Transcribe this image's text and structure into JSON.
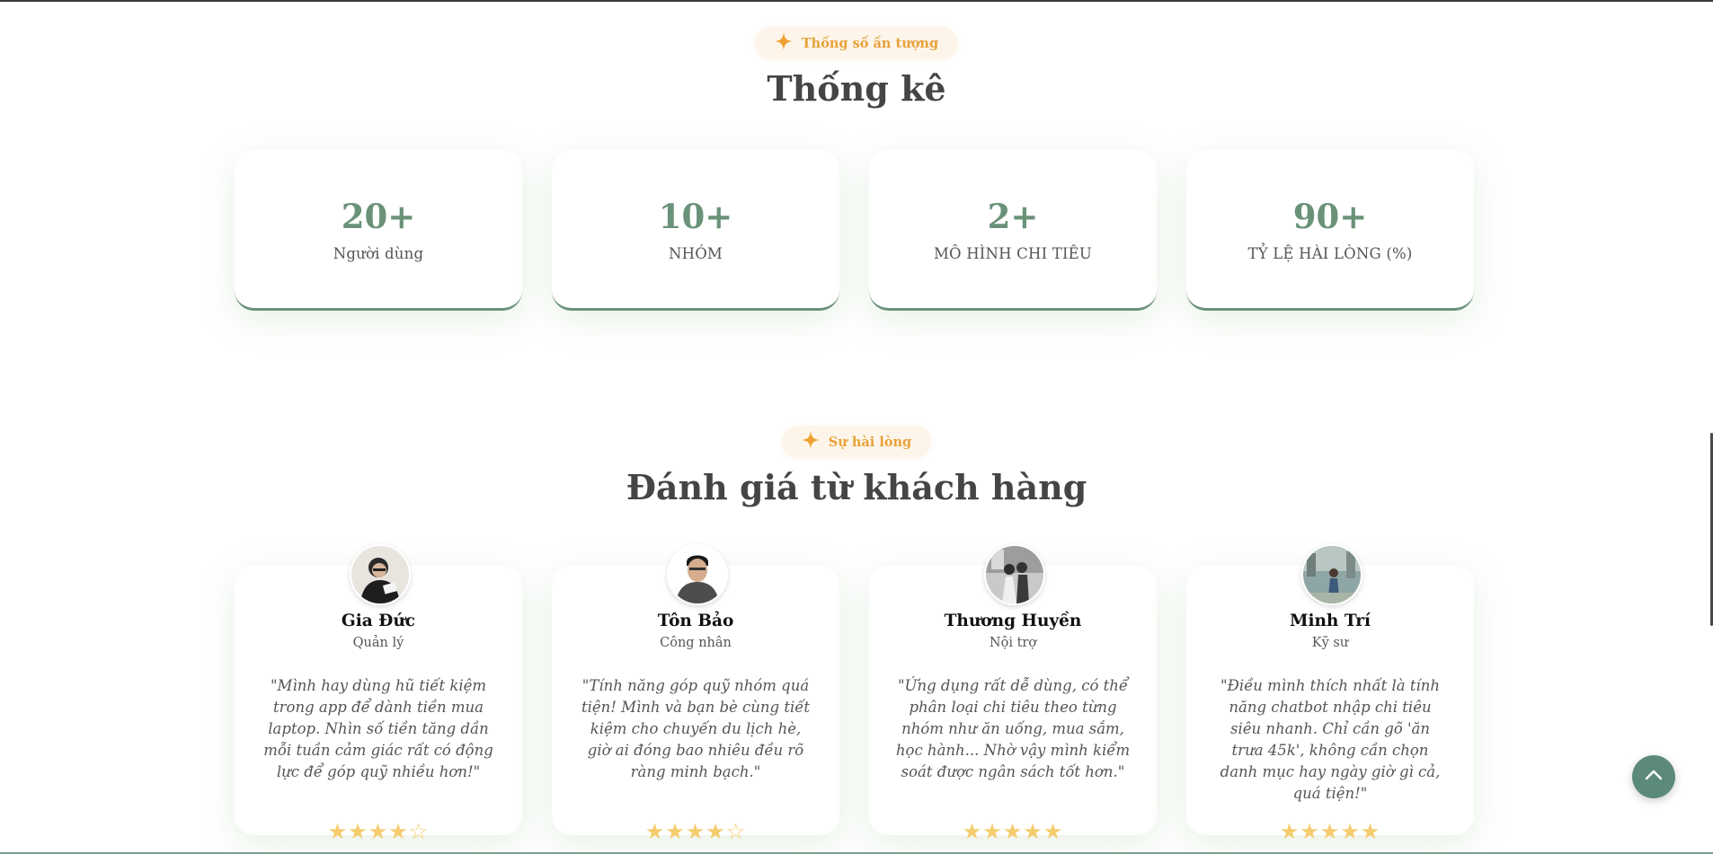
{
  "stats_section": {
    "badge": "Thống số ấn tượng",
    "title": "Thống kê",
    "cards": [
      {
        "value": "20+",
        "label": "Người dùng"
      },
      {
        "value": "10+",
        "label": "NHÓM"
      },
      {
        "value": "2+",
        "label": "MÔ HÌNH CHI TIÊU"
      },
      {
        "value": "90+",
        "label": "TỶ LỆ HÀI LÒNG (%)"
      }
    ]
  },
  "reviews_section": {
    "badge": "Sự hài lòng",
    "title": "Đánh giá từ khách hàng",
    "reviews": [
      {
        "name": "Gia Đức",
        "role": "Quản lý",
        "quote": "\"Mình hay dùng hũ tiết kiệm trong app để dành tiền mua laptop. Nhìn số tiền tăng dần mỗi tuần cảm giác rất có động lực để góp quỹ nhiều hơn!\"",
        "rating": 4
      },
      {
        "name": "Tôn Bảo",
        "role": "Công nhân",
        "quote": "\"Tính năng góp quỹ nhóm quá tiện! Mình và bạn bè cùng tiết kiệm cho chuyến du lịch hè, giờ ai đóng bao nhiêu đều rõ ràng minh bạch.\"",
        "rating": 4
      },
      {
        "name": "Thương Huyền",
        "role": "Nội trợ",
        "quote": "\"Ứng dụng rất dễ dùng, có thể phân loại chi tiêu theo từng nhóm như ăn uống, mua sắm, học hành... Nhờ vậy mình kiểm soát được ngân sách tốt hơn.\"",
        "rating": 5
      },
      {
        "name": "Minh Trí",
        "role": "Kỹ sư",
        "quote": "\"Điều mình thích nhất là tính năng chatbot nhập chi tiêu siêu nhanh. Chỉ cần gõ 'ăn trưa 45k', không cần chọn danh mục hay ngày giờ gì cả, quá tiện!\"",
        "rating": 5
      }
    ]
  },
  "icons": {
    "badge": "sparkle-icon",
    "back_to_top": "chevron-up-icon",
    "star": "star-icon"
  },
  "colors": {
    "accent_green": "#6a9279",
    "badge_orange": "#e8a23a",
    "star": "#f5cc6e",
    "back_to_top": "#5c8a7a"
  }
}
